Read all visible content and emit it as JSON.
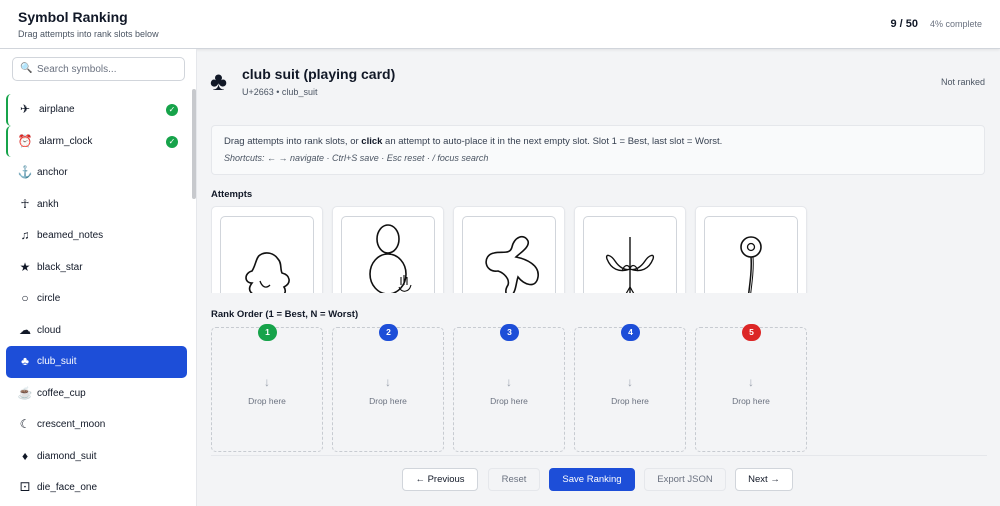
{
  "header": {
    "title": "Symbol Ranking",
    "subtitle": "Drag attempts into rank slots below",
    "progress": "9 / 50",
    "percent": "4% complete"
  },
  "sidebar": {
    "search_placeholder": "Search symbols...",
    "items": [
      {
        "icon": "✈",
        "label": "airplane",
        "done": true
      },
      {
        "icon": "⏰",
        "label": "alarm_clock",
        "done": true
      },
      {
        "icon": "⚓",
        "label": "anchor",
        "done": false
      },
      {
        "icon": "☥",
        "label": "ankh",
        "done": false
      },
      {
        "icon": "♫",
        "label": "beamed_notes",
        "done": false
      },
      {
        "icon": "★",
        "label": "black_star",
        "done": false
      },
      {
        "icon": "○",
        "label": "circle",
        "done": false
      },
      {
        "icon": "☁",
        "label": "cloud",
        "done": false
      },
      {
        "icon": "♣",
        "label": "club_suit",
        "done": false,
        "active": true
      },
      {
        "icon": "☕",
        "label": "coffee_cup",
        "done": false
      },
      {
        "icon": "☾",
        "label": "crescent_moon",
        "done": false
      },
      {
        "icon": "♦",
        "label": "diamond_suit",
        "done": false
      },
      {
        "icon": "⚀",
        "label": "die_face_one",
        "done": false
      }
    ]
  },
  "symbol": {
    "icon": "♣",
    "name": "club suit (playing card)",
    "code": "U+2663 • club_suit",
    "status": "Not ranked"
  },
  "instructions": {
    "line1_pre": "Drag attempts into rank slots, or ",
    "line1_bold": "click",
    "line1_post": " an attempt to auto-place it in the next empty slot. Slot 1 = Best, last slot = Worst.",
    "line2": "Shortcuts: ← → navigate · Ctrl+S save · Esc reset · / focus search"
  },
  "attempts_label": "Attempts",
  "rank_label": "Rank Order (1 = Best, N = Worst)",
  "slots": [
    {
      "number": "1",
      "color": "#16a34a",
      "arrow": "↓",
      "text": "Drop here"
    },
    {
      "number": "2",
      "color": "#1d4ed8",
      "arrow": "↓",
      "text": "Drop here"
    },
    {
      "number": "3",
      "color": "#1d4ed8",
      "arrow": "↓",
      "text": "Drop here"
    },
    {
      "number": "4",
      "color": "#1d4ed8",
      "arrow": "↓",
      "text": "Drop here"
    },
    {
      "number": "5",
      "color": "#dc2626",
      "arrow": "↓",
      "text": "Drop here"
    }
  ],
  "buttons": {
    "previous": "← Previous",
    "reset": "Reset",
    "save": "Save Ranking",
    "export": "Export JSON",
    "next": "Next →"
  },
  "colors": {
    "accent": "#1d4ed8",
    "done": "#16a34a",
    "worst": "#dc2626"
  }
}
